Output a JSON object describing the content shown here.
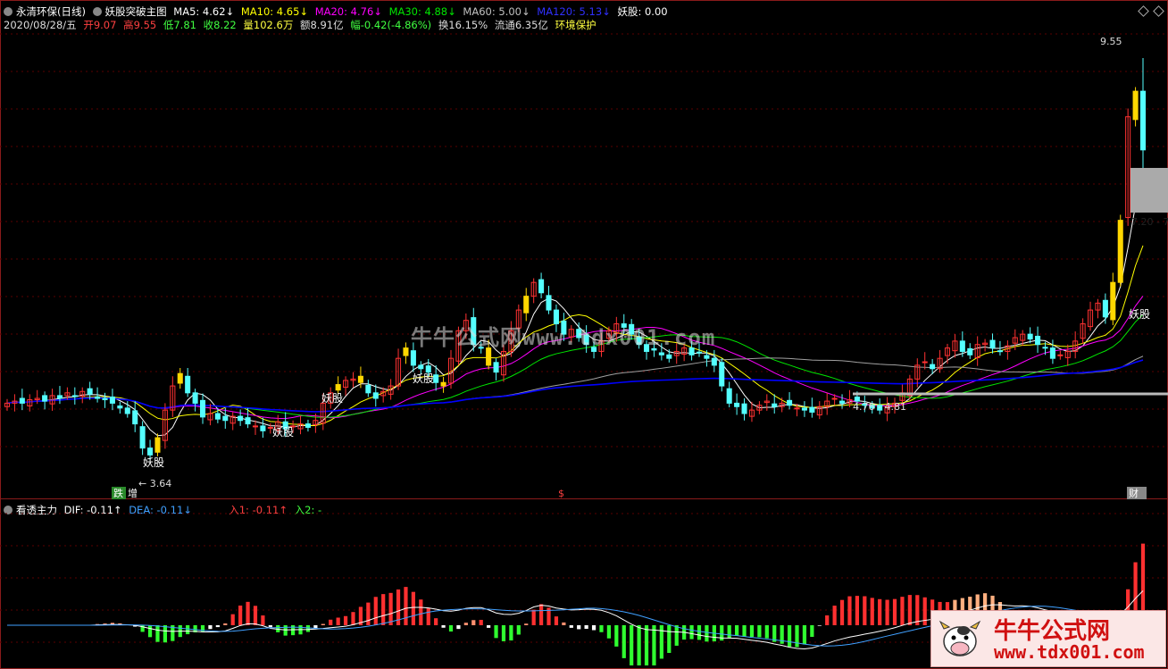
{
  "title_row": {
    "stock": "永清环保(日线)",
    "indicator": "妖股突破主图",
    "ma5": "MA5: 4.62↓",
    "ma10": "MA10: 4.65↓",
    "ma20": "MA20: 4.76↓",
    "ma30": "MA30: 4.88↓",
    "ma60": "MA60: 5.00↓",
    "ma120": "MA120: 5.13↓",
    "yaogu": "妖股: 0.00"
  },
  "info_row": {
    "date": "2020/08/28/五",
    "open": "开9.07",
    "high": "高9.55",
    "low": "低7.81",
    "close": "收8.22",
    "volume": "量102.6万",
    "amount": "额8.91亿",
    "change": "幅-0.42(-4.86%)",
    "turnover": "换16.15%",
    "float": "流通6.35亿",
    "concept": "环境保护"
  },
  "price_labels": {
    "high_mark": "9.55",
    "low_mark": "3.64",
    "range_mark": "4.76 - 4.81",
    "right_mark": "7.20 - 7",
    "signal": "妖股",
    "die": "跌",
    "zeng": "增",
    "dollar": "$",
    "caicai": "财"
  },
  "macd_row": {
    "name": "看透主力",
    "dif": "DIF: -0.11↑",
    "dea": "DEA: -0.11↓",
    "in1": "入1: -0.11↑",
    "in2": "入2: -"
  },
  "watermark": "牛牛公式网www.tdx001.com",
  "logo": {
    "line1": "牛牛公式网",
    "line2": "www.tdx001.com"
  },
  "colors": {
    "up": "#ff3232",
    "down": "#54ffff",
    "yaogu_bar": "#ffd700",
    "ma5": "#ffffff",
    "ma10": "#ffff00",
    "ma20": "#ff00ff",
    "ma30": "#00e600",
    "ma60": "#a0a0a0",
    "ma120": "#0000ff"
  },
  "chart_data": {
    "type": "candlestick",
    "price_range": [
      3.64,
      9.55
    ],
    "closes": [
      4.55,
      4.58,
      4.55,
      4.6,
      4.62,
      4.58,
      4.66,
      4.62,
      4.7,
      4.65,
      4.72,
      4.68,
      4.62,
      4.6,
      4.55,
      4.48,
      4.4,
      4.25,
      3.9,
      3.8,
      4.05,
      4.45,
      4.8,
      4.98,
      4.7,
      4.55,
      4.35,
      4.4,
      4.32,
      4.3,
      4.36,
      4.3,
      4.25,
      4.22,
      4.15,
      4.2,
      4.28,
      4.18,
      4.22,
      4.25,
      4.2,
      4.3,
      4.55,
      4.7,
      4.82,
      4.88,
      4.9,
      4.85,
      4.7,
      4.62,
      4.72,
      4.8,
      5.2,
      5.35,
      5.1,
      5.05,
      5.0,
      4.85,
      4.8,
      5.2,
      5.6,
      5.75,
      5.4,
      5.35,
      5.1,
      5.0,
      5.3,
      5.6,
      5.9,
      6.1,
      6.3,
      6.15,
      5.9,
      5.7,
      5.55,
      5.62,
      5.5,
      5.4,
      5.3,
      5.45,
      5.6,
      5.7,
      5.65,
      5.55,
      5.4,
      5.3,
      5.32,
      5.25,
      5.2,
      5.3,
      5.35,
      5.25,
      5.28,
      5.2,
      5.1,
      4.8,
      4.55,
      4.5,
      4.4,
      4.45,
      4.52,
      4.58,
      4.5,
      4.55,
      4.52,
      4.48,
      4.45,
      4.42,
      4.5,
      4.58,
      4.62,
      4.55,
      4.6,
      4.58,
      4.52,
      4.48,
      4.45,
      4.5,
      4.55,
      4.7,
      4.9,
      5.1,
      5.15,
      5.05,
      5.2,
      5.35,
      5.45,
      5.3,
      5.25,
      5.4,
      5.42,
      5.35,
      5.3,
      5.38,
      5.5,
      5.55,
      5.48,
      5.4,
      5.35,
      5.2,
      5.25,
      5.3,
      5.45,
      5.7,
      5.9,
      6.0,
      5.8,
      6.3,
      7.2,
      8.7,
      9.07,
      8.22
    ],
    "yaogu_signal_bars": [
      20,
      23,
      44,
      47,
      53,
      58,
      64,
      69,
      147,
      148,
      150
    ],
    "macd_dif": "approx -0.11",
    "macd_dea": "approx -0.11"
  }
}
